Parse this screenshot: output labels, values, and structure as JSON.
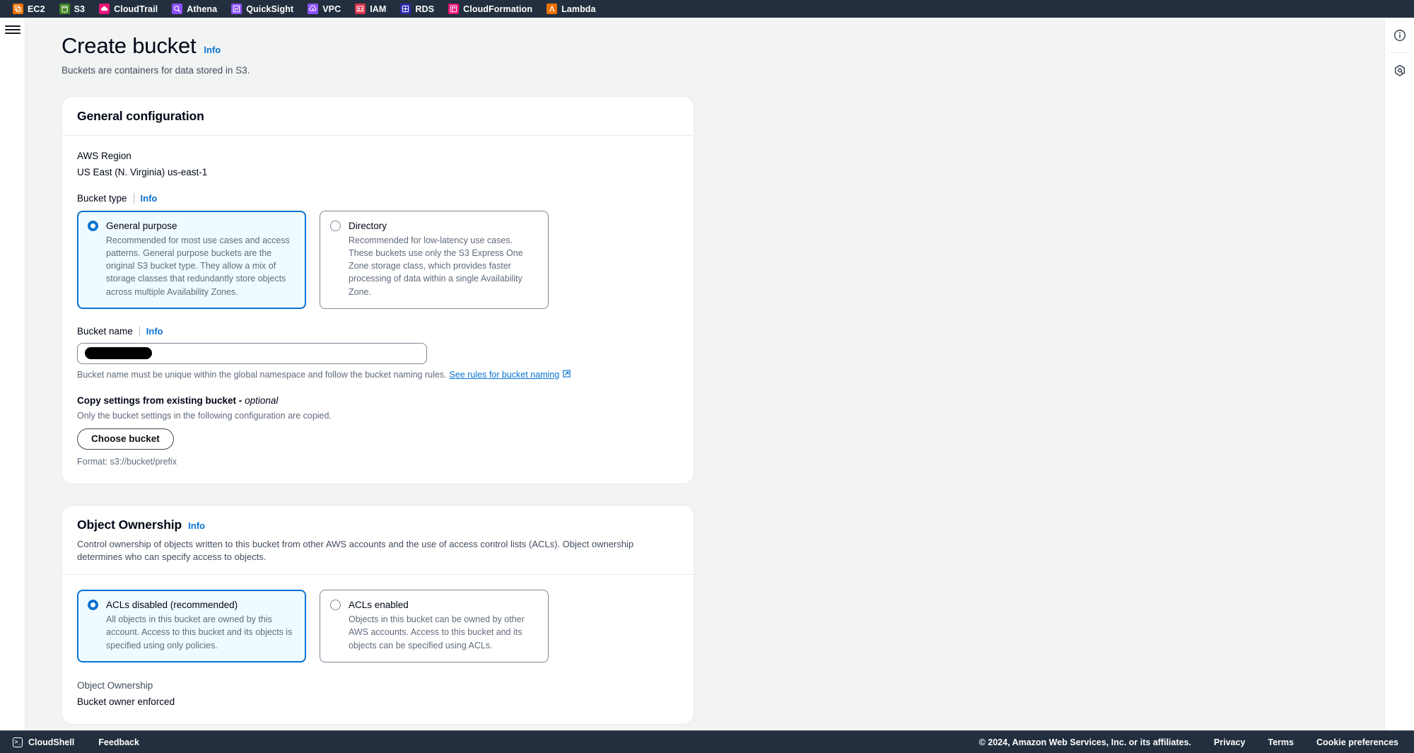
{
  "service_bar": {
    "items": [
      {
        "label": "EC2",
        "icon": "ec2-icon",
        "color": "#ed7100"
      },
      {
        "label": "S3",
        "icon": "s3-icon",
        "color": "#3f8624"
      },
      {
        "label": "CloudTrail",
        "icon": "cloudtrail-icon",
        "color": "#e7157b"
      },
      {
        "label": "Athena",
        "icon": "athena-icon",
        "color": "#8c4fff"
      },
      {
        "label": "QuickSight",
        "icon": "quicksight-icon",
        "color": "#8c4fff"
      },
      {
        "label": "VPC",
        "icon": "vpc-icon",
        "color": "#8c4fff"
      },
      {
        "label": "IAM",
        "icon": "iam-icon",
        "color": "#dd344c"
      },
      {
        "label": "RDS",
        "icon": "rds-icon",
        "color": "#2e27ad"
      },
      {
        "label": "CloudFormation",
        "icon": "cloudformation-icon",
        "color": "#e7157b"
      },
      {
        "label": "Lambda",
        "icon": "lambda-icon",
        "color": "#ed7100"
      }
    ]
  },
  "header": {
    "title": "Create bucket",
    "info_label": "Info",
    "subtitle": "Buckets are containers for data stored in S3."
  },
  "general_configuration": {
    "title": "General configuration",
    "region_label": "AWS Region",
    "region_value": "US East (N. Virginia) us-east-1",
    "bucket_type_label": "Bucket type",
    "bucket_type_info": "Info",
    "bucket_type_options": [
      {
        "title": "General purpose",
        "description": "Recommended for most use cases and access patterns. General purpose buckets are the original S3 bucket type. They allow a mix of storage classes that redundantly store objects across multiple Availability Zones.",
        "selected": true
      },
      {
        "title": "Directory",
        "description": "Recommended for low-latency use cases. These buckets use only the S3 Express One Zone storage class, which provides faster processing of data within a single Availability Zone.",
        "selected": false
      }
    ],
    "bucket_name_label": "Bucket name",
    "bucket_name_info": "Info",
    "bucket_name_value": "",
    "bucket_name_redacted": true,
    "bucket_name_helper": "Bucket name must be unique within the global namespace and follow the bucket naming rules.",
    "bucket_name_link": "See rules for bucket naming",
    "copy_settings_label": "Copy settings from existing bucket -",
    "copy_settings_optional": "optional",
    "copy_settings_desc": "Only the bucket settings in the following configuration are copied.",
    "choose_bucket_button": "Choose bucket",
    "format_note": "Format: s3://bucket/prefix"
  },
  "object_ownership": {
    "title": "Object Ownership",
    "info_label": "Info",
    "description": "Control ownership of objects written to this bucket from other AWS accounts and the use of access control lists (ACLs). Object ownership determines who can specify access to objects.",
    "options": [
      {
        "title": "ACLs disabled (recommended)",
        "description": "All objects in this bucket are owned by this account. Access to this bucket and its objects is specified using only policies.",
        "selected": true
      },
      {
        "title": "ACLs enabled",
        "description": "Objects in this bucket can be owned by other AWS accounts. Access to this bucket and its objects can be specified using ACLs.",
        "selected": false
      }
    ],
    "summary_label": "Object Ownership",
    "summary_value": "Bucket owner enforced"
  },
  "right_rail": {
    "info_panel_icon": "info-circle-icon",
    "shortcuts_icon": "hexagon-settings-icon"
  },
  "footer": {
    "cloudshell": "CloudShell",
    "feedback": "Feedback",
    "copyright": "© 2024, Amazon Web Services, Inc. or its affiliates.",
    "privacy": "Privacy",
    "terms": "Terms",
    "cookie_preferences": "Cookie preferences"
  },
  "colors": {
    "accent": "#0972d3",
    "nav_background": "#232f3e",
    "page_background": "#f2f3f3",
    "selected_tile_background": "#f0fbff"
  }
}
